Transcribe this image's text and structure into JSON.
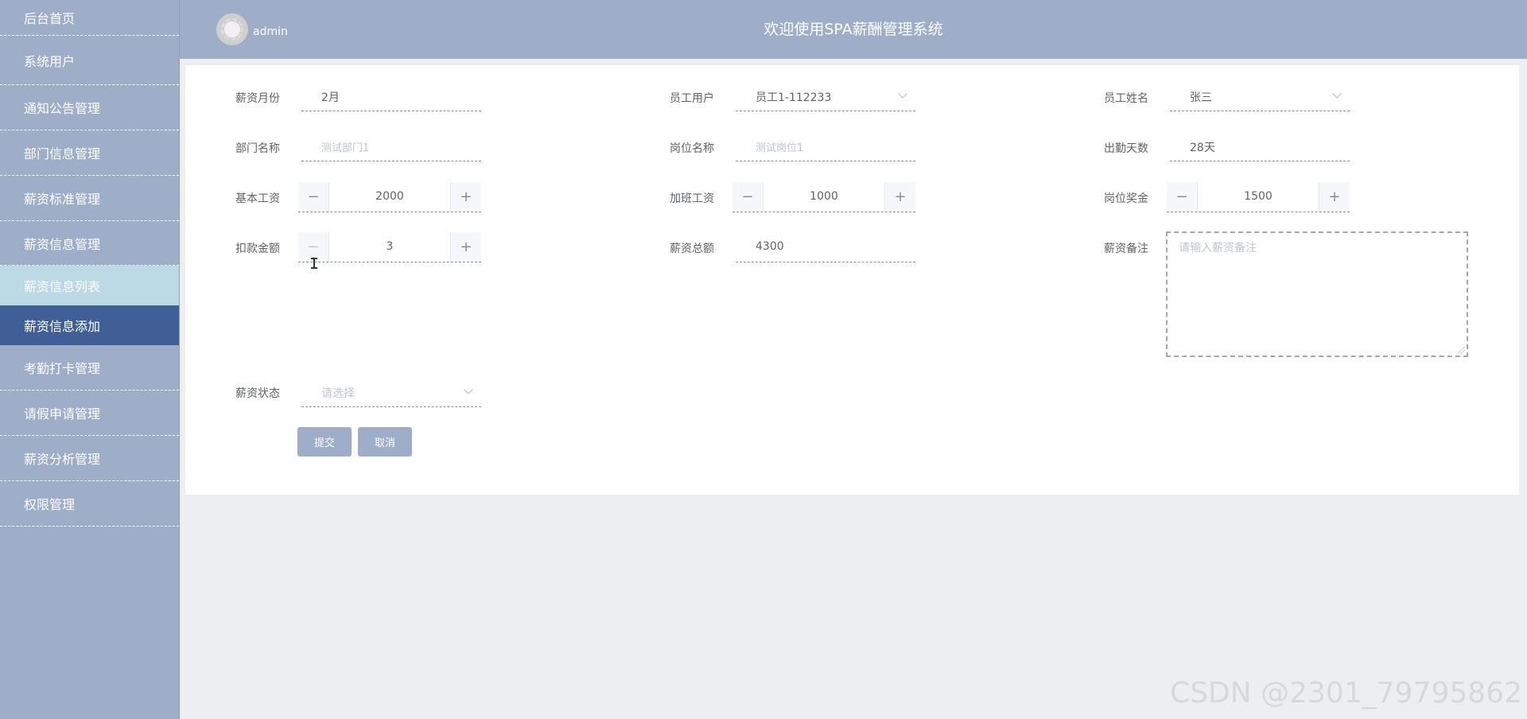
{
  "header": {
    "title": "欢迎使用SPA薪酬管理系统",
    "username": "admin"
  },
  "sidebar": {
    "items": [
      {
        "label": "后台首页"
      },
      {
        "label": "系统用户"
      },
      {
        "label": "通知公告管理"
      },
      {
        "label": "部门信息管理"
      },
      {
        "label": "薪资标准管理"
      },
      {
        "label": "薪资信息管理"
      },
      {
        "label": "薪资信息列表"
      },
      {
        "label": "薪资信息添加"
      },
      {
        "label": "考勤打卡管理"
      },
      {
        "label": "请假申请管理"
      },
      {
        "label": "薪资分析管理"
      },
      {
        "label": "权限管理"
      }
    ]
  },
  "form": {
    "month": {
      "label": "薪资月份",
      "value": "2月"
    },
    "employee_user": {
      "label": "员工用户",
      "value": "员工1-112233"
    },
    "employee_name": {
      "label": "员工姓名",
      "value": "张三"
    },
    "department": {
      "label": "部门名称",
      "placeholder": "测试部门1"
    },
    "position": {
      "label": "岗位名称",
      "placeholder": "测试岗位1"
    },
    "attendance_days": {
      "label": "出勤天数",
      "value": "28天"
    },
    "base_salary": {
      "label": "基本工资",
      "value": "2000"
    },
    "overtime_pay": {
      "label": "加班工资",
      "value": "1000"
    },
    "position_bonus": {
      "label": "岗位奖金",
      "value": "1500"
    },
    "deduction": {
      "label": "扣款金额",
      "value": "3"
    },
    "total_salary": {
      "label": "薪资总额",
      "value": "4300"
    },
    "remark": {
      "label": "薪资备注",
      "placeholder": "请输入薪资备注"
    },
    "status": {
      "label": "薪资状态",
      "placeholder": "请选择"
    },
    "submit_label": "提交",
    "cancel_label": "取消"
  },
  "stepper_symbols": {
    "minus": "−",
    "plus": "+"
  },
  "watermark": "CSDN @2301_79795862",
  "colors": {
    "sidebar_bg": "#9eadc8",
    "sidebar_current": "#3f5f96",
    "sidebar_sub_active": "#bcd9e6",
    "button_bg": "#9eadc8"
  }
}
